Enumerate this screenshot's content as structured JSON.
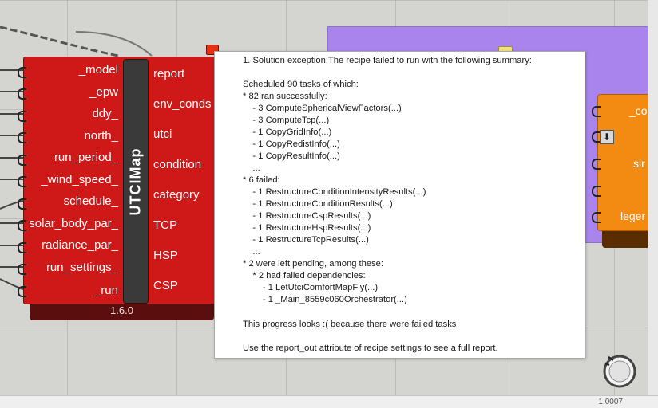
{
  "canvas": {
    "zoom": "1.0007"
  },
  "utci_component": {
    "name": "UTCIMap",
    "version": "1.6.0",
    "inputs": [
      "_model",
      "_epw",
      "ddy_",
      "north_",
      "run_period_",
      "_wind_speed_",
      "schedule_",
      "solar_body_par_",
      "radiance_par_",
      "run_settings_",
      "_run"
    ],
    "outputs": [
      "report",
      "env_conds",
      "utci",
      "condition",
      "category",
      "TCP",
      "HSP",
      "CSP"
    ]
  },
  "orange_component": {
    "labels": [
      "_co",
      "sir",
      "leger"
    ]
  },
  "tooltip": {
    "lines": [
      "1. Solution exception:The recipe failed to run with the following summary:",
      "",
      "Scheduled 90 tasks of which:",
      "* 82 ran successfully:",
      "    - 3 ComputeSphericalViewFactors(...)",
      "    - 3 ComputeTcp(...)",
      "    - 1 CopyGridInfo(...)",
      "    - 1 CopyRedistInfo(...)",
      "    - 1 CopyResultInfo(...)",
      "    ...",
      "* 6 failed:",
      "    - 1 RestructureConditionIntensityResults(...)",
      "    - 1 RestructureConditionResults(...)",
      "    - 1 RestructureCspResults(...)",
      "    - 1 RestructureHspResults(...)",
      "    - 1 RestructureTcpResults(...)",
      "    ...",
      "* 2 were left pending, among these:",
      "    * 2 had failed dependencies:",
      "        - 1 LetUtciComfortMapFly(...)",
      "        - 1 _Main_8559c060Orchestrator(...)",
      "",
      "This progress looks :( because there were failed tasks",
      "",
      "Use the report_out attribute of recipe settings to see a full report."
    ]
  },
  "colors": {
    "component_red": "#cf1818",
    "component_orange": "#f38a12",
    "component_purple": "#a884ec",
    "canvas": "#d4d4d0",
    "warning": "#e63010"
  }
}
